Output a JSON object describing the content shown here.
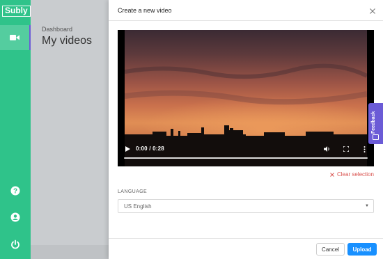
{
  "app": {
    "logo_text": "Subly"
  },
  "sidebar": {
    "items": [
      {
        "icon": "video-camera-icon"
      },
      {
        "icon": "help-icon"
      },
      {
        "icon": "account-icon"
      },
      {
        "icon": "power-icon"
      }
    ],
    "accent_color": "#2fc38a",
    "active_indicator_color": "#6b5bd6"
  },
  "dashboard": {
    "breadcrumb": "Dashboard",
    "title": "My videos"
  },
  "panel": {
    "title": "Create a new video",
    "video": {
      "time_display": "0:00 / 0:28",
      "progress": 0
    },
    "clear_selection_label": "Clear selection",
    "language": {
      "label": "LANGUAGE",
      "selected": "US English"
    },
    "buttons": {
      "cancel": "Cancel",
      "upload": "Upload"
    },
    "upload_color": "#1890ff"
  },
  "feedback": {
    "label": "Feedback",
    "color": "#6b5bd6"
  }
}
